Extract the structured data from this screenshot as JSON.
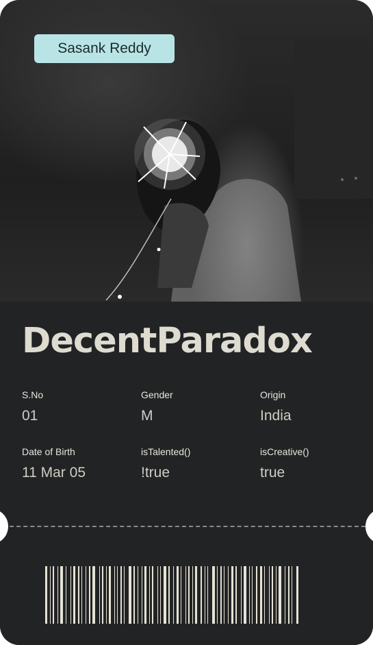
{
  "card": {
    "owner_name": "Sasank Reddy",
    "handle": "DecentParadox",
    "photo_icon": "person-with-light-orb-photo",
    "fields": [
      {
        "label": "S.No",
        "value": "01"
      },
      {
        "label": "Gender",
        "value": "M"
      },
      {
        "label": "Origin",
        "value": "India"
      },
      {
        "label": "Date of Birth",
        "value": "11 Mar 05"
      },
      {
        "label": "isTalented()",
        "value": "!true"
      },
      {
        "label": "isCreative()",
        "value": "true"
      }
    ]
  },
  "colors": {
    "card_background": "#222324",
    "name_tag_background": "#b9e4e6",
    "handle_text": "#dedbd0",
    "barcode": "#e6e3d6"
  }
}
